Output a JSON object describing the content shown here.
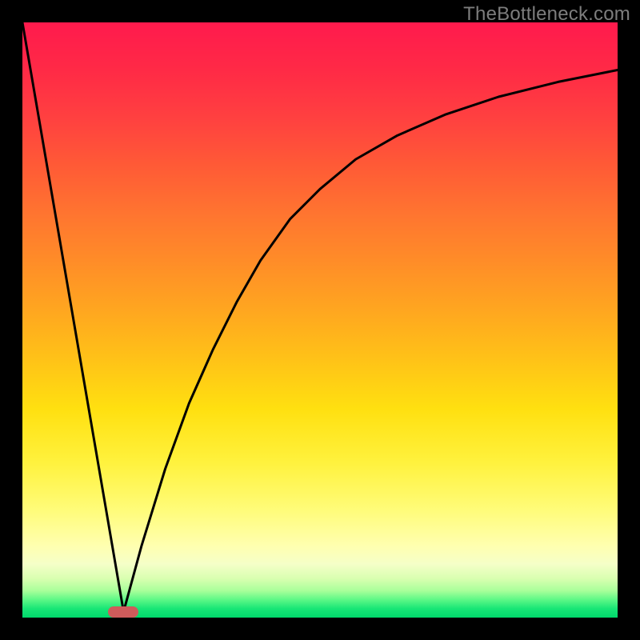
{
  "watermark": "TheBottleneck.com",
  "colors": {
    "frame": "#000000",
    "curve": "#000000",
    "marker": "#cf5b5b",
    "watermark_text": "#7d7d7d"
  },
  "chart_data": {
    "type": "line",
    "title": "",
    "xlabel": "",
    "ylabel": "",
    "xlim": [
      0,
      100
    ],
    "ylim": [
      0,
      100
    ],
    "grid": false,
    "legend": false,
    "annotations": [
      "TheBottleneck.com"
    ],
    "marker": {
      "x": 17,
      "y": 1
    },
    "series": [
      {
        "name": "left-descending-line",
        "x": [
          0,
          17
        ],
        "y": [
          100,
          1
        ]
      },
      {
        "name": "right-rising-curve",
        "x": [
          17,
          20,
          24,
          28,
          32,
          36,
          40,
          45,
          50,
          56,
          63,
          71,
          80,
          90,
          100
        ],
        "y": [
          1,
          12,
          25,
          36,
          45,
          53,
          60,
          67,
          72,
          77,
          81,
          84.5,
          87.5,
          90,
          92
        ]
      }
    ]
  }
}
